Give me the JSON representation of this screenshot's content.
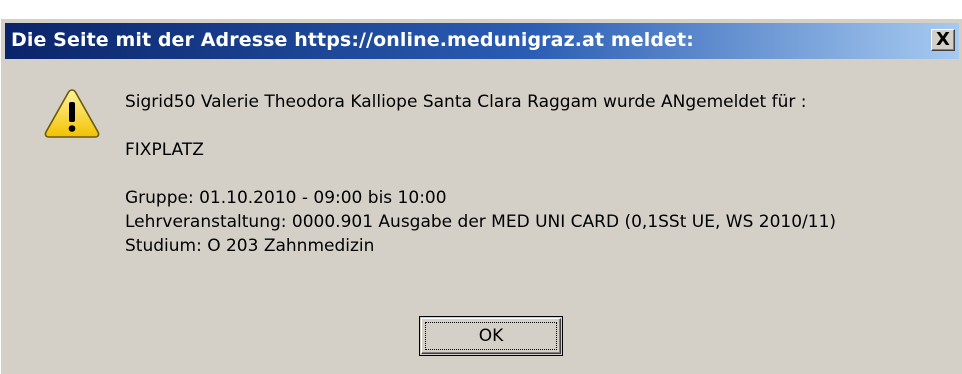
{
  "dialog": {
    "title": "Die Seite mit der Adresse https://online.medunigraz.at meldet:",
    "close_label": "X",
    "icon": "warning-icon",
    "message_lines": [
      "Sigrid50 Valerie Theodora Kalliope Santa Clara Raggam wurde ANgemeldet für :",
      "",
      "FIXPLATZ",
      "",
      "Gruppe: 01.10.2010 - 09:00 bis 10:00",
      "Lehrveranstaltung: 0000.901 Ausgabe der MED UNI CARD (0,1SSt UE, WS 2010/11)",
      "Studium: O 203 Zahnmedizin"
    ],
    "ok_label": "OK"
  },
  "colors": {
    "titlebar_start": "#0a246a",
    "titlebar_end": "#a6caf0",
    "dialog_bg": "#d4d0c8",
    "warning_fill": "#ffd700"
  }
}
